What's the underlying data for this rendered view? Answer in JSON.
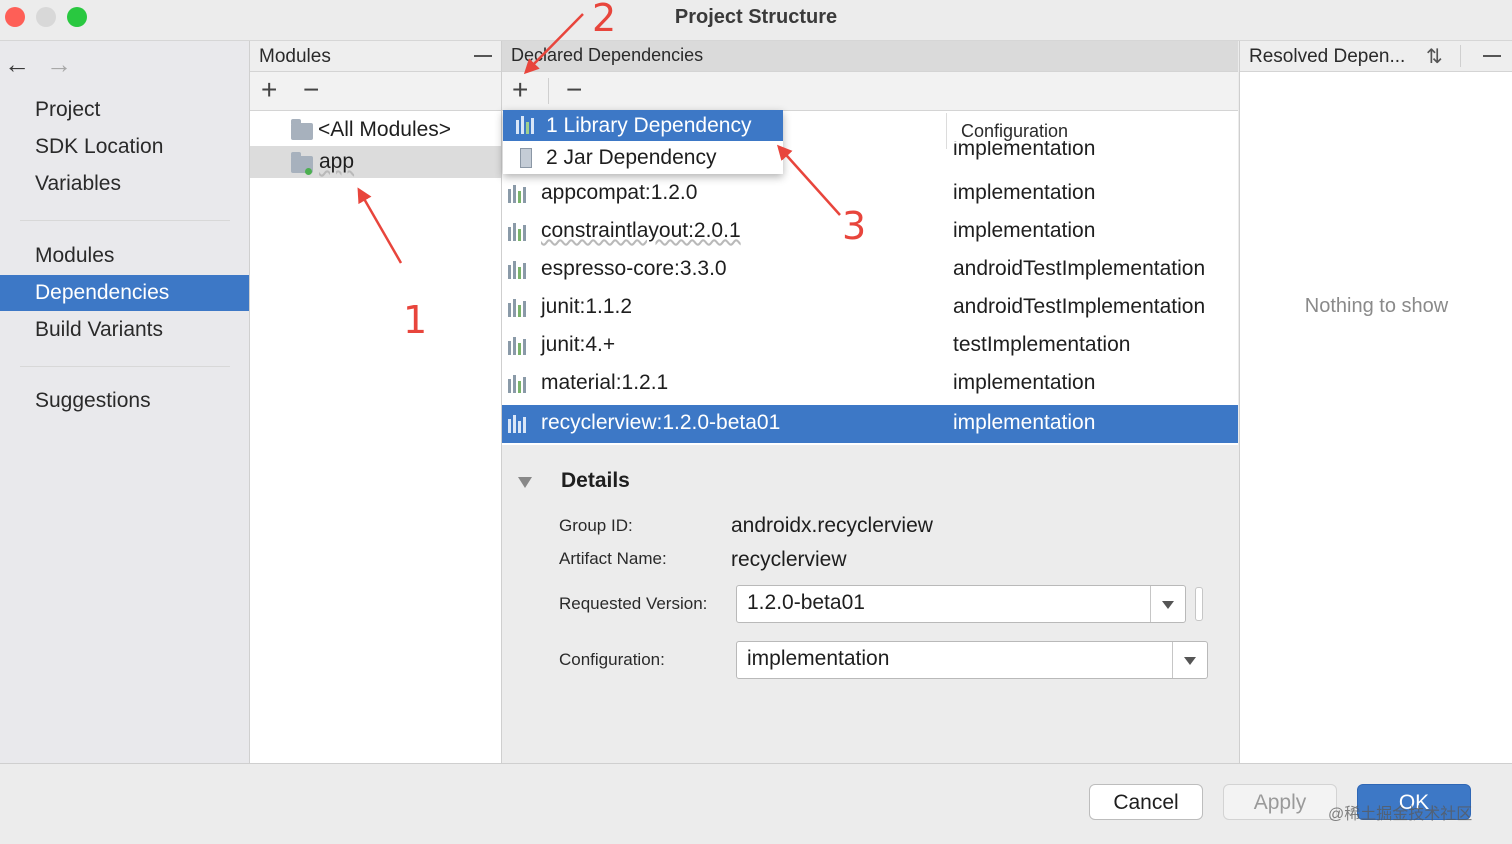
{
  "window": {
    "title": "Project Structure"
  },
  "colors": {
    "accent": "#3d78c6",
    "annotation": "#e8453c",
    "close": "#fe5f57",
    "minimize": "#d8d8d8",
    "zoom": "#29c840"
  },
  "nav": {
    "back_icon": "arrow-left-icon",
    "forward_icon": "arrow-right-icon",
    "groups": [
      [
        "Project",
        "SDK Location",
        "Variables"
      ],
      [
        "Modules",
        "Dependencies",
        "Build Variants"
      ],
      [
        "Suggestions"
      ]
    ],
    "selected": "Dependencies"
  },
  "modules_panel": {
    "title": "Modules",
    "items": [
      "<All Modules>",
      "app"
    ],
    "selected": "app"
  },
  "declared_panel": {
    "title": "Declared Dependencies",
    "config_header": "Configuration",
    "add_menu": [
      "1  Library Dependency",
      "2  Jar Dependency"
    ],
    "rows": [
      {
        "name": "",
        "config": "implementation"
      },
      {
        "name": "appcompat:1.2.0",
        "config": "implementation"
      },
      {
        "name": "constraintlayout:2.0.1",
        "config": "implementation"
      },
      {
        "name": "espresso-core:3.3.0",
        "config": "androidTestImplementation"
      },
      {
        "name": "junit:1.1.2",
        "config": "androidTestImplementation"
      },
      {
        "name": "junit:4.+",
        "config": "testImplementation"
      },
      {
        "name": "material:1.2.1",
        "config": "implementation"
      },
      {
        "name": "recyclerview:1.2.0-beta01",
        "config": "implementation"
      }
    ],
    "selected": "recyclerview:1.2.0-beta01"
  },
  "details": {
    "title": "Details",
    "group_id_label": "Group ID:",
    "group_id": "androidx.recyclerview",
    "artifact_label": "Artifact Name:",
    "artifact": "recyclerview",
    "version_label": "Requested Version:",
    "version": "1.2.0-beta01",
    "config_label": "Configuration:",
    "config": "implementation"
  },
  "resolved_panel": {
    "title": "Resolved Depen...",
    "empty_text": "Nothing to show"
  },
  "buttons": {
    "cancel": "Cancel",
    "apply": "Apply",
    "ok": "OK"
  },
  "watermark": "@稀土掘金技术社区",
  "annotations": [
    "1",
    "2",
    "3"
  ]
}
